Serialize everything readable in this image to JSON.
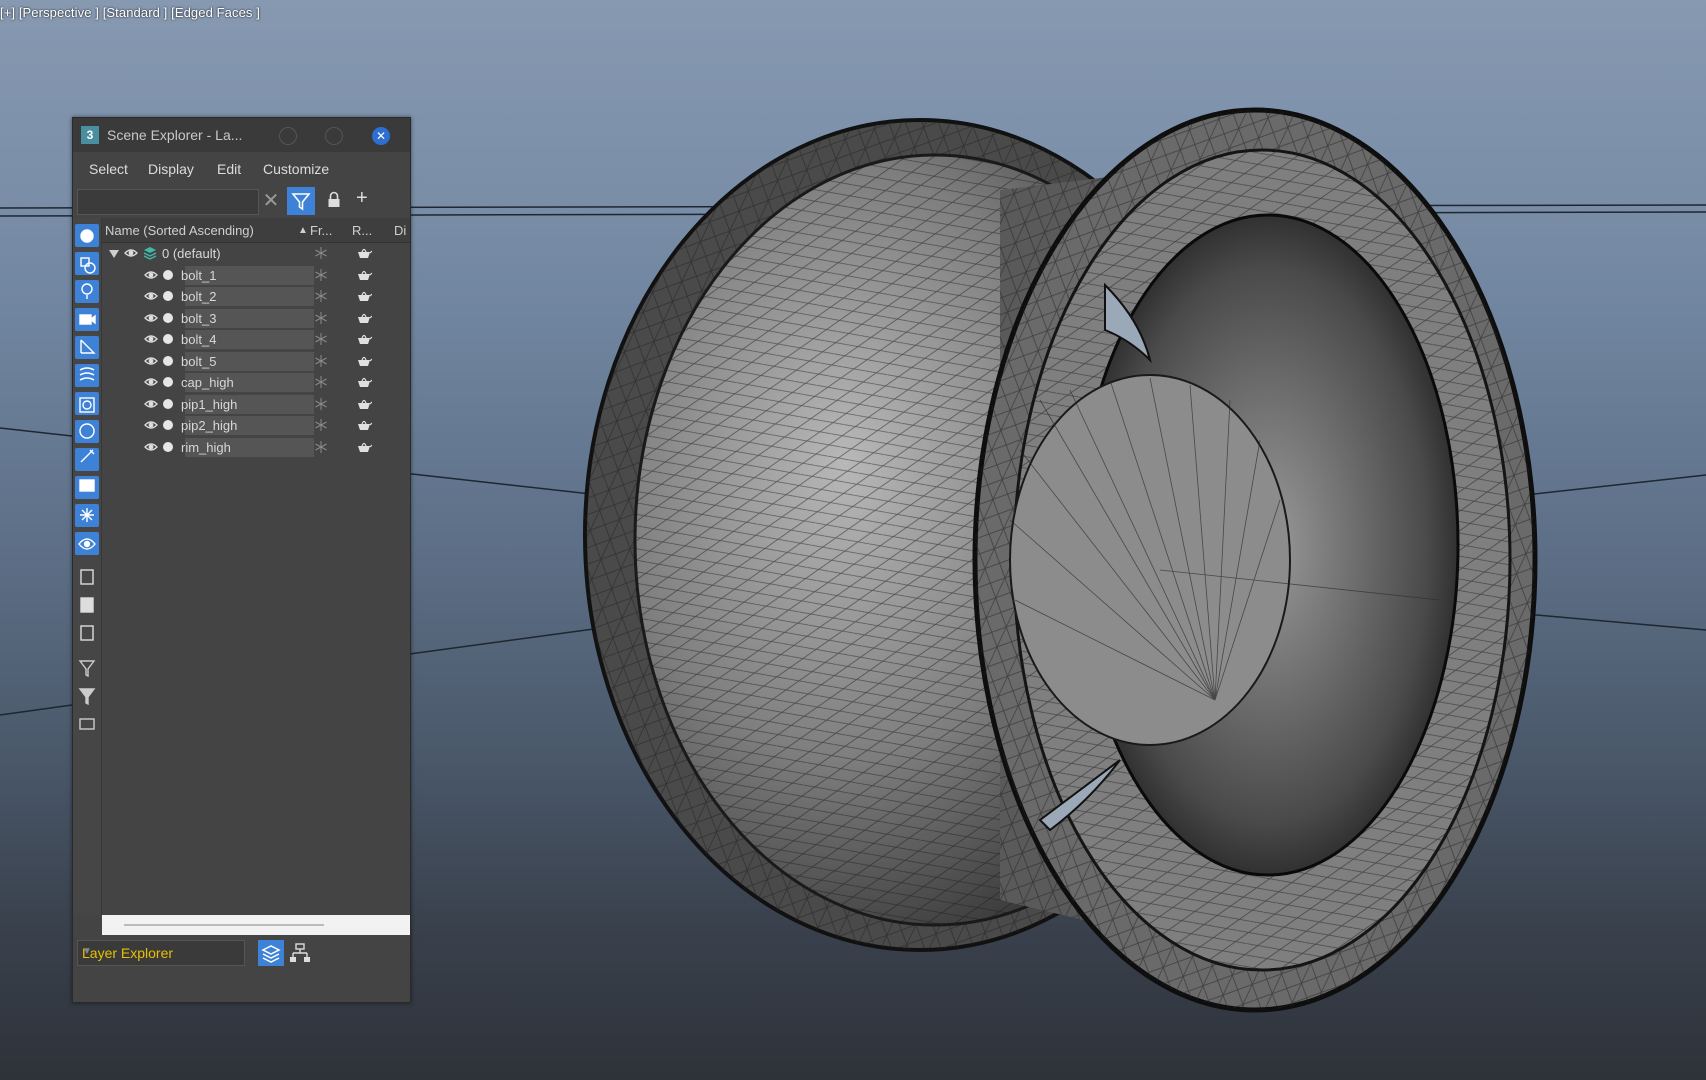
{
  "viewport": {
    "label": "[+] [Perspective ] [Standard ] [Edged Faces ]"
  },
  "scene_explorer": {
    "title": "Scene Explorer - La...",
    "app_icon": "3",
    "close_glyph": "✕",
    "menu": [
      "Select",
      "Display",
      "Edit",
      "Customize"
    ],
    "search_placeholder": "",
    "clear_glyph": "✕",
    "add_glyph": "+",
    "columns": {
      "name": "Name (Sorted Ascending)",
      "sort_glyph": "▲",
      "frozen": "Fr...",
      "render": "R...",
      "display": "Di"
    },
    "root": {
      "label": "0 (default)",
      "expanded": true
    },
    "items": [
      {
        "label": "bolt_1"
      },
      {
        "label": "bolt_2"
      },
      {
        "label": "bolt_3"
      },
      {
        "label": "bolt_4"
      },
      {
        "label": "bolt_5"
      },
      {
        "label": "cap_high"
      },
      {
        "label": "pip1_high"
      },
      {
        "label": "pip2_high"
      },
      {
        "label": "rim_high"
      }
    ],
    "explorer_mode": "Layer Explorer",
    "side_toolbar_icons": [
      "display-geometry-icon",
      "display-shapes-icon",
      "display-lights-icon",
      "display-cameras-icon",
      "display-helpers-icon",
      "display-spacewarps-icon",
      "display-groups-icon",
      "display-xrefs-icon",
      "display-bones-icon",
      "display-containers-icon",
      "display-frozen-icon",
      "display-hidden-icon",
      "display-all-icon",
      "display-none-icon",
      "display-invert-icon",
      "filter-selected-icon",
      "filter-icon",
      "container-icon"
    ],
    "colors": {
      "accent": "#3d82d6",
      "layer_text": "#e8c000",
      "panel_bg": "#444444"
    }
  }
}
